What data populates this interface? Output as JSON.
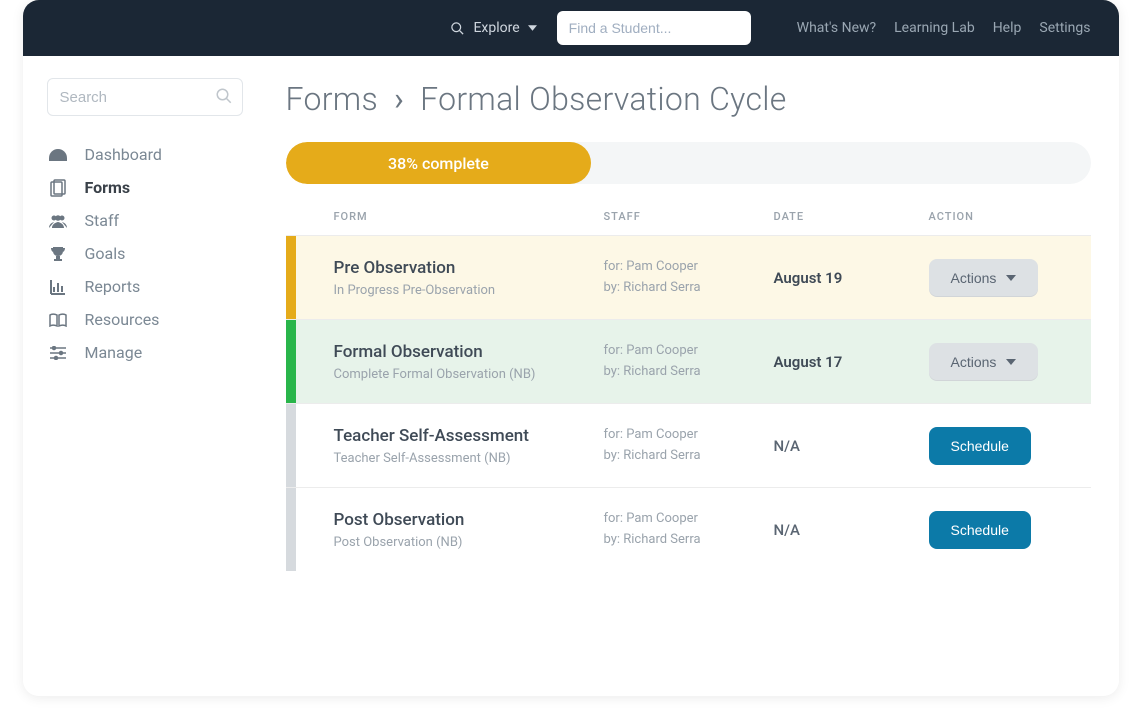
{
  "topnav": {
    "explore_label": "Explore",
    "student_placeholder": "Find a Student...",
    "links": {
      "whats_new": "What's New?",
      "learning_lab": "Learning Lab",
      "help": "Help",
      "settings": "Settings"
    }
  },
  "sidebar": {
    "search_placeholder": "Search",
    "items": [
      {
        "label": "Dashboard"
      },
      {
        "label": "Forms"
      },
      {
        "label": "Staff"
      },
      {
        "label": "Goals"
      },
      {
        "label": "Reports"
      },
      {
        "label": "Resources"
      },
      {
        "label": "Manage"
      }
    ],
    "active_index": 1
  },
  "breadcrumb": {
    "root": "Forms",
    "current": "Formal Observation Cycle"
  },
  "progress": {
    "percent": 38,
    "label": "38% complete"
  },
  "columns": {
    "form": "FORM",
    "staff": "STAFF",
    "date": "DATE",
    "action": "ACTION"
  },
  "rows": [
    {
      "status": "inprogress",
      "title": "Pre Observation",
      "subtitle": "In Progress Pre-Observation",
      "for_label": "for: Pam Cooper",
      "by_label": "by: Richard Serra",
      "date": "August 19",
      "action_type": "actions",
      "action_label": "Actions"
    },
    {
      "status": "complete",
      "title": "Formal Observation",
      "subtitle": "Complete Formal Observation (NB)",
      "for_label": "for: Pam Cooper",
      "by_label": "by: Richard Serra",
      "date": "August 17",
      "action_type": "actions",
      "action_label": "Actions"
    },
    {
      "status": "pending",
      "title": "Teacher Self-Assessment",
      "subtitle": "Teacher Self-Assessment (NB)",
      "for_label": "for: Pam Cooper",
      "by_label": "by: Richard Serra",
      "date": "N/A",
      "action_type": "schedule",
      "action_label": "Schedule"
    },
    {
      "status": "pending",
      "title": "Post Observation",
      "subtitle": "Post Observation (NB)",
      "for_label": "for: Pam Cooper",
      "by_label": "by: Richard Serra",
      "date": "N/A",
      "action_type": "schedule",
      "action_label": "Schedule"
    }
  ],
  "colors": {
    "accent_orange": "#e5ab1a",
    "accent_green": "#29b54a",
    "accent_blue": "#0c7aa8",
    "topnav_bg": "#1b2735"
  }
}
